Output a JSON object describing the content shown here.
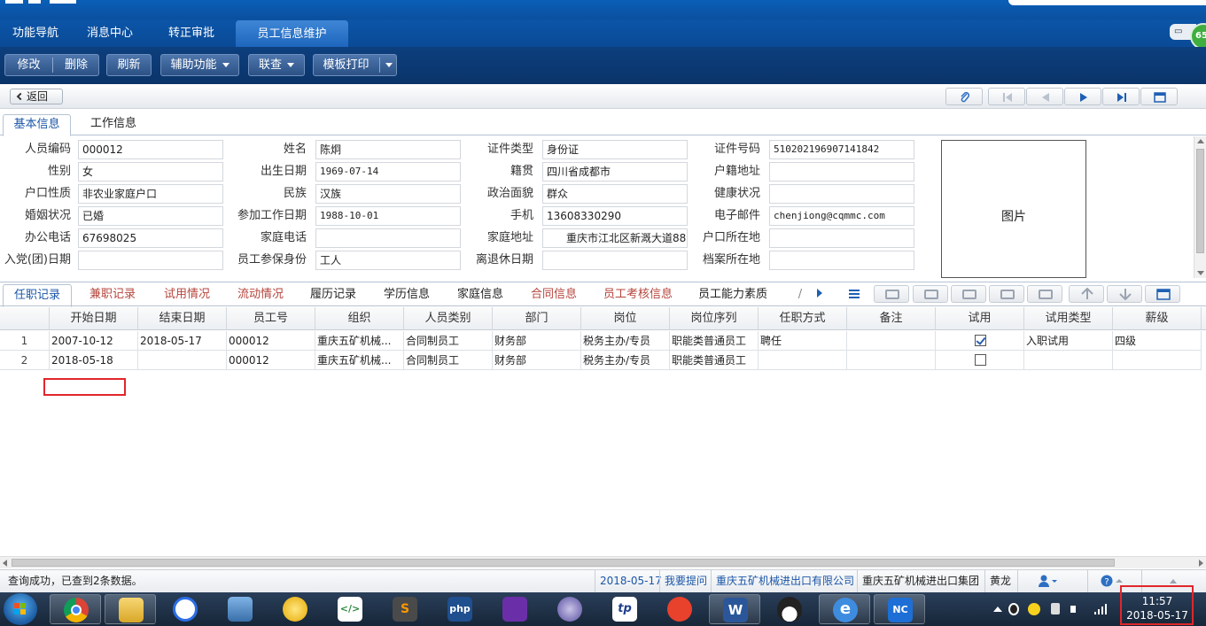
{
  "module_tabs": [
    {
      "label": "功能导航"
    },
    {
      "label": "消息中心"
    },
    {
      "label": "转正审批"
    },
    {
      "label": "员工信息维护"
    }
  ],
  "top_badge": "65",
  "toolbar": {
    "edit": "修改",
    "delete": "删除",
    "refresh": "刷新",
    "assist": "辅助功能",
    "linked_query": "联查",
    "template_print": "模板打印"
  },
  "nav": {
    "back": "返回"
  },
  "info_tabs": [
    {
      "label": "基本信息"
    },
    {
      "label": "工作信息"
    }
  ],
  "form": {
    "fields": [
      {
        "label": "人员编码",
        "value": "000012"
      },
      {
        "label": "姓名",
        "value": "陈炯"
      },
      {
        "label": "证件类型",
        "value": "身份证"
      },
      {
        "label": "证件号码",
        "value": "510202196907141842"
      },
      {
        "label": "性别",
        "value": "女"
      },
      {
        "label": "出生日期",
        "value": "1969-07-14"
      },
      {
        "label": "籍贯",
        "value": "四川省成都市"
      },
      {
        "label": "户籍地址",
        "value": ""
      },
      {
        "label": "户口性质",
        "value": "非农业家庭户口"
      },
      {
        "label": "民族",
        "value": "汉族"
      },
      {
        "label": "政治面貌",
        "value": "群众"
      },
      {
        "label": "健康状况",
        "value": ""
      },
      {
        "label": "婚姻状况",
        "value": "已婚"
      },
      {
        "label": "参加工作日期",
        "value": "1988-10-01"
      },
      {
        "label": "手机",
        "value": "13608330290"
      },
      {
        "label": "电子邮件",
        "value": "chenjiong@cqmmc.com"
      },
      {
        "label": "办公电话",
        "value": "67698025"
      },
      {
        "label": "家庭电话",
        "value": ""
      },
      {
        "label": "家庭地址",
        "value": "重庆市江北区新溉大道88"
      },
      {
        "label": "户口所在地",
        "value": ""
      },
      {
        "label": "入党(团)日期",
        "value": ""
      },
      {
        "label": "员工参保身份",
        "value": "工人"
      },
      {
        "label": "离退休日期",
        "value": ""
      },
      {
        "label": "档案所在地",
        "value": ""
      }
    ],
    "photo_label": "图片"
  },
  "sub_tabs": [
    {
      "label": "任职记录"
    },
    {
      "label": "兼职记录"
    },
    {
      "label": "试用情况"
    },
    {
      "label": "流动情况"
    },
    {
      "label": "履历记录"
    },
    {
      "label": "学历信息"
    },
    {
      "label": "家庭信息"
    },
    {
      "label": "合同信息"
    },
    {
      "label": "员工考核信息"
    },
    {
      "label": "员工能力素质"
    },
    {
      "label": "/"
    }
  ],
  "grid": {
    "columns": [
      "开始日期",
      "结束日期",
      "员工号",
      "组织",
      "人员类别",
      "部门",
      "岗位",
      "岗位序列",
      "任职方式",
      "备注",
      "试用",
      "试用类型",
      "薪级"
    ],
    "rows": [
      {
        "index": "1",
        "cells": [
          "2007-10-12",
          "2018-05-17",
          "000012",
          "重庆五矿机械...",
          "合同制员工",
          "财务部",
          "税务主办/专员",
          "职能类普通员工",
          "聘任",
          "",
          "",
          "入职试用",
          "四级"
        ],
        "trial_checked": true
      },
      {
        "index": "2",
        "cells": [
          "2018-05-18",
          "",
          "000012",
          "重庆五矿机械...",
          "合同制员工",
          "财务部",
          "税务主办/专员",
          "职能类普通员工",
          "",
          "",
          "",
          "",
          ""
        ],
        "trial_checked": false
      }
    ]
  },
  "status": {
    "message": "查询成功，已查到2条数据。",
    "date": "2018-05-17",
    "ask": "我要提问",
    "company": "重庆五矿机械进出口有限公司",
    "group": "重庆五矿机械进出口集团",
    "user": "黄龙"
  },
  "taskbar": {
    "apps": [
      {
        "name": "chrome-icon"
      },
      {
        "name": "file-explorer-icon"
      },
      {
        "name": "baidu-netdisk-icon"
      },
      {
        "name": "remote-desktop-icon"
      },
      {
        "name": "media-player-icon"
      },
      {
        "name": "code-editor-icon",
        "glyph": "</>"
      },
      {
        "name": "sublime-text-icon",
        "glyph": "S"
      },
      {
        "name": "phpstudy-icon",
        "glyph": "php"
      },
      {
        "name": "visual-studio-icon"
      },
      {
        "name": "eclipse-icon"
      },
      {
        "name": "thinkphp-icon",
        "glyph": "tp"
      },
      {
        "name": "browser-red-icon"
      },
      {
        "name": "word-icon",
        "glyph": "W"
      },
      {
        "name": "qq-icon"
      },
      {
        "name": "internet-explorer-icon",
        "glyph": "e"
      },
      {
        "name": "nc-client-icon",
        "glyph": "NC"
      }
    ],
    "time": "11:57",
    "date": "2018-05-17"
  },
  "colors": {
    "accent": "#1a56a8",
    "toolbar": "#0b3a74",
    "highlight": "#e0262b",
    "red_tab": "#b5453c"
  }
}
